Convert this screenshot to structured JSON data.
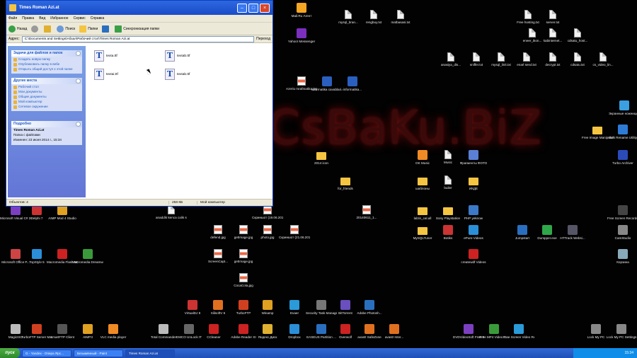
{
  "wallpaper_text": "CsBaKu.BiZ",
  "window": {
    "title": "Times Roman Azi.at",
    "menu": [
      "Файл",
      "Правка",
      "Вид",
      "Избранное",
      "Сервис",
      "Справка"
    ],
    "toolbar": {
      "back": "Назад",
      "search": "Поиск",
      "folders": "Папки",
      "sync": "Синхронизация папки"
    },
    "address_label": "Адрес:",
    "address": "C:\\Documents and Settings\\Абзал\\Рабочий стол\\Times Roman Azi.at",
    "go": "Переход",
    "tasks": {
      "header": "Задачи для файлов и папок",
      "items": [
        "Создать новую папку",
        "Опубликовать папку в вебе",
        "Открыть общий доступ к этой папке"
      ]
    },
    "places": {
      "header": "Другие места",
      "items": [
        "Рабочий стол",
        "Мои документы",
        "Общие документы",
        "Мой компьютер",
        "Сетевое окружение"
      ]
    },
    "details": {
      "header": "Подробно",
      "name": "Times Roman Azi.at",
      "type": "Папка с файлами",
      "modified": "Изменен: 23 июня 2014 г., 15:34"
    },
    "files": [
      "texta.ttf",
      "textab.ttf",
      "textai.ttf",
      "textab.ttf"
    ],
    "status": {
      "objects": "Объектов: 4",
      "size": "258 КБ",
      "location": "Мой компьютер"
    }
  },
  "desktop_icons": [
    {
      "label": "Mail.Ru Агент",
      "kind": "app",
      "color": "#f5a623"
    },
    {
      "label": "mysql_bran...",
      "kind": "file"
    },
    {
      "label": "rengbuy.txt",
      "kind": "file"
    },
    {
      "label": "matbasasi.txt",
      "kind": "file"
    },
    {
      "label": "Free hosting.txt",
      "kind": "file"
    },
    {
      "label": "server.txt",
      "kind": "file"
    },
    {
      "label": "Yahoo! Messenger",
      "kind": "app",
      "color": "#7b2fbf"
    },
    {
      "label": "eneer_ikon...",
      "kind": "file"
    },
    {
      "label": "kabinternet...",
      "kind": "file"
    },
    {
      "label": "cdsatu_host...",
      "kind": "file"
    },
    {
      "label": "anasiya_dis...",
      "kind": "file"
    },
    {
      "label": "sniffer.txt",
      "kind": "file"
    },
    {
      "label": "mysql_linit.txt",
      "kind": "file"
    },
    {
      "label": "enarl send.txt",
      "kind": "file"
    },
    {
      "label": "decrypt.txt",
      "kind": "file"
    },
    {
      "label": "cdsatu.txt",
      "kind": "file"
    },
    {
      "label": "cs_video_lin...",
      "kind": "file"
    },
    {
      "label": "Azeriu mrafmatika.jpg",
      "kind": "img"
    },
    {
      "label": "informatika cavablari.docx",
      "kind": "app",
      "color": "#2b5fbf"
    },
    {
      "label": "informatika...",
      "kind": "app",
      "color": "#2b5fbf"
    },
    {
      "label": "Экранные ножницы.exe",
      "kind": "app",
      "color": "#3aa0e0"
    },
    {
      "label": "Free Image Manipulator",
      "kind": "folder"
    },
    {
      "label": "Bulk Rename Utility",
      "kind": "app",
      "color": "#2e7bd6"
    },
    {
      "label": "OK Music",
      "kind": "app",
      "color": "#f08a24"
    },
    {
      "label": "Music",
      "kind": "file"
    },
    {
      "label": "Фрагменты ФОТО",
      "kind": "app",
      "color": "#5b7fd6"
    },
    {
      "label": "Turbo Archiver",
      "kind": "app",
      "color": "#2b4bb8"
    },
    {
      "label": "2014 icon",
      "kind": "folder"
    },
    {
      "label": "for_friends",
      "kind": "folder"
    },
    {
      "label": "шаблоны",
      "kind": "folder"
    },
    {
      "label": "builer",
      "kind": "file"
    },
    {
      "label": "ИКДЕ",
      "kind": "folder"
    },
    {
      "label": "Microsoft Visual C# 2010",
      "kind": "app",
      "color": "#7c3fc0"
    },
    {
      "label": "Delphi 7",
      "kind": "app",
      "color": "#c33"
    },
    {
      "label": "AIMP Mod 4 Studio",
      "kind": "app",
      "color": "#e0a020"
    },
    {
      "label": "anaddik kenca calik suelta...",
      "kind": "file"
    },
    {
      "label": "Скриншот (19.06.201...",
      "kind": "img"
    },
    {
      "label": "20140611_1...",
      "kind": "img"
    },
    {
      "label": "lalzin_cal.all",
      "kind": "folder"
    },
    {
      "label": "Sony Playstation",
      "kind": "folder"
    },
    {
      "label": "PHP yeknow",
      "kind": "app",
      "color": "#3c79c8"
    },
    {
      "label": "Free Screen Recorder",
      "kind": "app",
      "color": "#444"
    },
    {
      "label": "defend.jpg",
      "kind": "img"
    },
    {
      "label": "getImage.jpg",
      "kind": "img"
    },
    {
      "label": "photo.jpg",
      "kind": "img"
    },
    {
      "label": "Скриншот (21.06.201...",
      "kind": "img"
    },
    {
      "label": "MySQLTuner",
      "kind": "folder"
    },
    {
      "label": "Botiks",
      "kind": "app",
      "color": "#c33"
    },
    {
      "label": "ePure Videos",
      "kind": "app",
      "color": "#2a8fd8"
    },
    {
      "label": "Jumpstart",
      "kind": "app",
      "color": "#2a6fbf"
    },
    {
      "label": "Dumpper.exe",
      "kind": "app",
      "color": "#2fa84a"
    },
    {
      "label": "HTTrack Websi...",
      "kind": "app",
      "color": "#556"
    },
    {
      "label": "CamStudio",
      "kind": "app",
      "color": "#888"
    },
    {
      "label": "Microsoft Office P...",
      "kind": "app",
      "color": "#c44"
    },
    {
      "label": "TopStyle 5",
      "kind": "app",
      "color": "#2a8fd8"
    },
    {
      "label": "Macromedia Flash MX 2004",
      "kind": "app",
      "color": "#c22"
    },
    {
      "label": "Macromedia Dreamwea...",
      "kind": "app",
      "color": "#3a9a3a"
    },
    {
      "label": "ScreenCapt...",
      "kind": "img"
    },
    {
      "label": "getImage.jpg",
      "kind": "img"
    },
    {
      "label": "createwdf Videos",
      "kind": "app",
      "color": "#c22"
    },
    {
      "label": "Корзина",
      "kind": "app",
      "color": "#8ab"
    },
    {
      "label": "CocaCola.jpg",
      "kind": "img"
    },
    {
      "label": "VirtualDJ 8",
      "kind": "app",
      "color": "#c33"
    },
    {
      "label": "XilisoftV 6",
      "kind": "app",
      "color": "#e07020"
    },
    {
      "label": "TurboFTP",
      "kind": "app",
      "color": "#d04020"
    },
    {
      "label": "Winamp",
      "kind": "app",
      "color": "#e0a020"
    },
    {
      "label": "Evaer",
      "kind": "app",
      "color": "#2a9ad8"
    },
    {
      "label": "Security Task Manager",
      "kind": "app",
      "color": "#777"
    },
    {
      "label": "BitTorrent",
      "kind": "app",
      "color": "#6a4fbf"
    },
    {
      "label": "Adobe Photosh...",
      "kind": "app",
      "color": "#2a6fbf"
    },
    {
      "label": "MagicISO",
      "kind": "app",
      "color": "#bbb"
    },
    {
      "label": "TurboFTP Server Ma...",
      "kind": "app",
      "color": "#d04020"
    },
    {
      "label": "SmartFTP Client",
      "kind": "app",
      "color": "#555"
    },
    {
      "label": "AIMP3",
      "kind": "app",
      "color": "#e0a020"
    },
    {
      "label": "VLC media player",
      "kind": "app",
      "color": "#f08a24"
    },
    {
      "label": "Total Commander",
      "kind": "app",
      "color": "#bbb"
    },
    {
      "label": "EMCO UnLock IT",
      "kind": "app",
      "color": "#666"
    },
    {
      "label": "CCleaner",
      "kind": "app",
      "color": "#c22"
    },
    {
      "label": "Adobe Reader XI",
      "kind": "app",
      "color": "#c22"
    },
    {
      "label": "Яндекс.Диск",
      "kind": "app",
      "color": "#e0b030"
    },
    {
      "label": "Dropbox",
      "kind": "app",
      "color": "#2a8fd8"
    },
    {
      "label": "EASEUS Partition ...",
      "kind": "app",
      "color": "#2a6fbf"
    },
    {
      "label": "Overwolf",
      "kind": "app",
      "color": "#c22"
    },
    {
      "label": "avast! SafeZone",
      "kind": "app",
      "color": "#e07020"
    },
    {
      "label": "avast! Inter...",
      "kind": "app",
      "color": "#e07020"
    },
    {
      "label": "DVDVideoSoft Free Studio",
      "kind": "app",
      "color": "#7c3fc0"
    },
    {
      "label": "Free MP4 Video C...",
      "kind": "app",
      "color": "#3a9a3a"
    },
    {
      "label": "Free Screen Video Re...",
      "kind": "app",
      "color": "#2a9ad8"
    },
    {
      "label": "Lock My PC",
      "kind": "app",
      "color": "#888"
    },
    {
      "label": "Lock My PC Settings",
      "kind": "app",
      "color": "#888"
    }
  ],
  "taskbar": {
    "start": "пуск",
    "buttons": [
      "G - Yandex - Опера Ярс...",
      "Безымянный - Paint",
      "Times Roman Azi.at"
    ],
    "clock": "15:34"
  }
}
